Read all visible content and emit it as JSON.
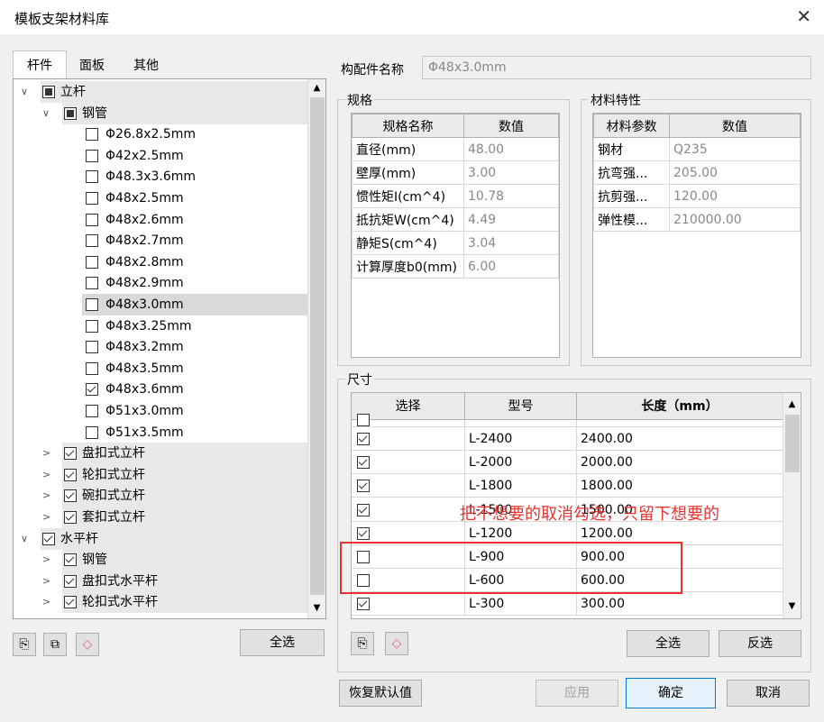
{
  "window": {
    "title": "模板支架材料库",
    "close": "✕"
  },
  "tabs": [
    "杆件",
    "面板",
    "其他"
  ],
  "tree": [
    {
      "level": 0,
      "expand": "∨",
      "check": "partial",
      "label": "立杆",
      "section": true
    },
    {
      "level": 1,
      "expand": "∨",
      "check": "partial",
      "label": "钢管",
      "section": true
    },
    {
      "level": 2,
      "check": "none",
      "label": "Φ26.8x2.5mm"
    },
    {
      "level": 2,
      "check": "none",
      "label": "Φ42x2.5mm"
    },
    {
      "level": 2,
      "check": "none",
      "label": "Φ48.3x3.6mm"
    },
    {
      "level": 2,
      "check": "none",
      "label": "Φ48x2.5mm"
    },
    {
      "level": 2,
      "check": "none",
      "label": "Φ48x2.6mm"
    },
    {
      "level": 2,
      "check": "none",
      "label": "Φ48x2.7mm"
    },
    {
      "level": 2,
      "check": "none",
      "label": "Φ48x2.8mm"
    },
    {
      "level": 2,
      "check": "none",
      "label": "Φ48x2.9mm"
    },
    {
      "level": 2,
      "check": "none",
      "label": "Φ48x3.0mm",
      "selected": true
    },
    {
      "level": 2,
      "check": "none",
      "label": "Φ48x3.25mm"
    },
    {
      "level": 2,
      "check": "none",
      "label": "Φ48x3.2mm"
    },
    {
      "level": 2,
      "check": "none",
      "label": "Φ48x3.5mm"
    },
    {
      "level": 2,
      "check": "checked",
      "label": "Φ48x3.6mm"
    },
    {
      "level": 2,
      "check": "none",
      "label": "Φ51x3.0mm"
    },
    {
      "level": 2,
      "check": "none",
      "label": "Φ51x3.5mm"
    },
    {
      "level": 1,
      "expand": ">",
      "check": "checked",
      "label": "盘扣式立杆",
      "section": true
    },
    {
      "level": 1,
      "expand": ">",
      "check": "checked",
      "label": "轮扣式立杆",
      "section": true
    },
    {
      "level": 1,
      "expand": ">",
      "check": "checked",
      "label": "碗扣式立杆",
      "section": true
    },
    {
      "level": 1,
      "expand": ">",
      "check": "checked",
      "label": "套扣式立杆",
      "section": true
    },
    {
      "level": 0,
      "expand": "∨",
      "check": "checked",
      "label": "水平杆",
      "section": true
    },
    {
      "level": 1,
      "expand": ">",
      "check": "checked",
      "label": "钢管",
      "section": true
    },
    {
      "level": 1,
      "expand": ">",
      "check": "checked",
      "label": "盘扣式水平杆",
      "section": true
    },
    {
      "level": 1,
      "expand": ">",
      "check": "checked",
      "label": "轮扣式水平杆",
      "section": true
    }
  ],
  "left_buttons": {
    "select_all": "全选"
  },
  "component": {
    "label": "构配件名称",
    "value": "Φ48x3.0mm"
  },
  "spec": {
    "title": "规格",
    "headers": [
      "规格名称",
      "数值"
    ],
    "rows": [
      [
        "直径(mm)",
        "48.00"
      ],
      [
        "壁厚(mm)",
        "3.00"
      ],
      [
        "惯性矩I(cm^4)",
        "10.78"
      ],
      [
        "抵抗矩W(cm^4)",
        "4.49"
      ],
      [
        "静矩S(cm^4)",
        "3.04"
      ],
      [
        "计算厚度b0(mm)",
        "6.00"
      ]
    ]
  },
  "material": {
    "title": "材料特性",
    "headers": [
      "材料参数",
      "数值"
    ],
    "rows": [
      [
        "钢材",
        "Q235"
      ],
      [
        "抗弯强...",
        "205.00"
      ],
      [
        "抗剪强...",
        "120.00"
      ],
      [
        "弹性模...",
        "210000.00"
      ]
    ]
  },
  "size": {
    "title": "尺寸",
    "headers": [
      "选择",
      "型号",
      "长度（mm）"
    ],
    "rows": [
      {
        "check": true,
        "model": "L-2400",
        "length": "2400.00"
      },
      {
        "check": true,
        "model": "L-2000",
        "length": "2000.00"
      },
      {
        "check": true,
        "model": "L-1800",
        "length": "1800.00"
      },
      {
        "check": true,
        "model": "L-1500",
        "length": "1500.00"
      },
      {
        "check": true,
        "model": "L-1200",
        "length": "1200.00"
      },
      {
        "check": false,
        "model": "L-900",
        "length": "900.00"
      },
      {
        "check": false,
        "model": "L-600",
        "length": "600.00"
      },
      {
        "check": true,
        "model": "L-300",
        "length": "300.00"
      }
    ],
    "select_all": "全选",
    "invert": "反选"
  },
  "annotation": "把不想要的取消勾选，只留下想要的",
  "footer": {
    "restore": "恢复默认值",
    "apply": "应用",
    "ok": "确定",
    "cancel": "取消"
  },
  "colors": {
    "annotation": "#e8322e",
    "selected_row": "#d9d9d9",
    "section_row": "#e8e8e8"
  }
}
